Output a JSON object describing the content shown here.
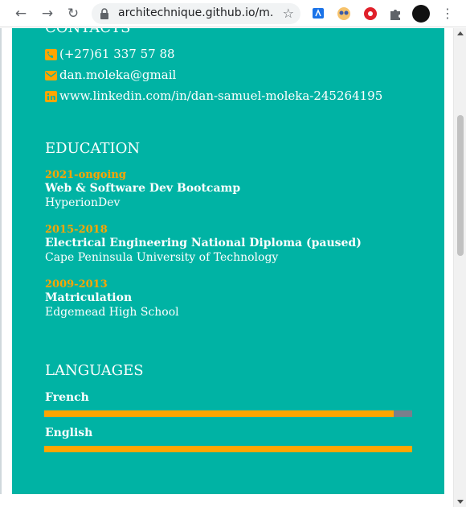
{
  "browser": {
    "url": "architechnique.github.io/m..."
  },
  "contacts": {
    "heading": "CONTACTS",
    "phone": "(+27)61 337 57 88",
    "email": "dan.moleka@gmail",
    "linkedin": "www.linkedin.com/in/dan-samuel-moleka-245264195"
  },
  "education": {
    "heading": "EDUCATION",
    "entries": [
      {
        "years": "2021-ongoing",
        "title": "Web & Software Dev Bootcamp",
        "school": "HyperionDev"
      },
      {
        "years": "2015-2018",
        "title": "Electrical Engineering National Diploma (paused)",
        "school": "Cape Peninsula University of Technology"
      },
      {
        "years": "2009-2013",
        "title": "Matriculation",
        "school": "Edgemead High School"
      }
    ]
  },
  "languages": {
    "heading": "LANGUAGES",
    "items": [
      {
        "name": "French",
        "level": 0.95
      },
      {
        "name": "English",
        "level": 1.0
      }
    ]
  },
  "colors": {
    "panel": "#00b3a4",
    "accent": "#ffa500",
    "track": "#7a7f8c"
  }
}
